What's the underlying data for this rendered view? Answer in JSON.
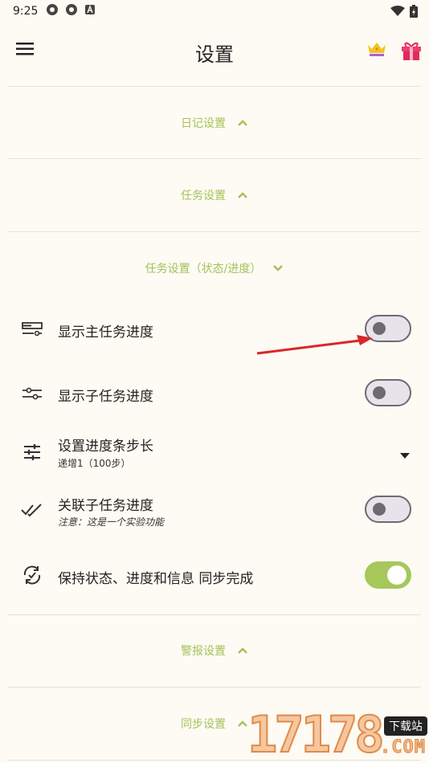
{
  "status_bar": {
    "time": "9:25"
  },
  "app_bar": {
    "title": "设置",
    "menu_icon": "hamburger-menu-icon",
    "crown_icon": "crown-icon",
    "gift_icon": "gift-icon"
  },
  "sections": {
    "diary": {
      "label": "日记设置",
      "state": "collapsed"
    },
    "task": {
      "label": "任务设置",
      "state": "collapsed"
    },
    "task_status": {
      "label": "任务设置（状态/进度）",
      "state": "expanded"
    },
    "alarm": {
      "label": "警报设置",
      "state": "collapsed"
    },
    "sync": {
      "label": "同步设置",
      "state": "collapsed"
    }
  },
  "settings": {
    "show_main_progress": {
      "title": "显示主任务进度",
      "enabled": false
    },
    "show_sub_progress": {
      "title": "显示子任务进度",
      "enabled": false
    },
    "progress_step": {
      "title": "设置进度条步长",
      "subtitle": "递增1（100步）"
    },
    "link_sub_progress": {
      "title": "关联子任务进度",
      "subtitle": "注意：这是一个实验功能",
      "enabled": false
    },
    "keep_sync": {
      "title": "保持状态、进度和信息 同步完成",
      "enabled": true
    }
  },
  "watermark": {
    "digits": "17178",
    "badge": "下载站",
    "domain": ".COM"
  },
  "colors": {
    "accent": "#a6c15a",
    "background": "#fdfbf3",
    "toggle_off": "#6f6a72",
    "annotation_arrow": "#d9262a"
  }
}
